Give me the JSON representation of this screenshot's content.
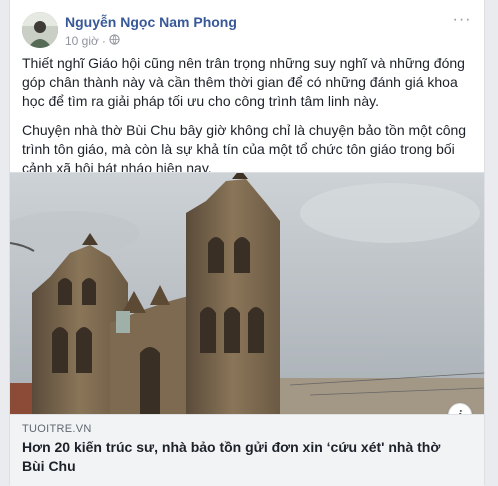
{
  "post": {
    "author": "Nguyễn Ngọc Nam Phong",
    "time": "10 giờ",
    "more_label": "···",
    "paragraphs": [
      "Thiết nghĩ Giáo hội cũng nên trân trọng những suy nghĩ và những đóng góp chân thành này và cần thêm thời gian để có những đánh giá khoa học để tìm ra giải pháp tối ưu cho công trình tâm linh này.",
      "Chuyện nhà thờ Bùi Chu bây giờ không chỉ là chuyện bảo tồn một công trình tôn giáo, mà còn là sự khả tín của một tổ chức tôn giáo trong bối cảnh xã hội bát nháo hiện nay."
    ]
  },
  "link": {
    "domain": "TUOITRE.VN",
    "title": "Hơn 20 kiến trúc sư, nhà bảo tồn gửi đơn xin ‘cứu xét' nhà thờ Bùi Chu",
    "info_label": "i"
  },
  "icons": {
    "privacy": "globe-icon",
    "info": "info-icon",
    "more": "more-options-icon"
  }
}
